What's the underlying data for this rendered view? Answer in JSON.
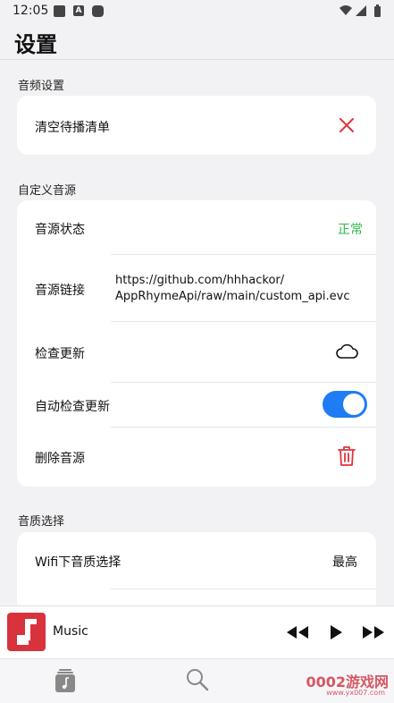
{
  "status_bar": {
    "time": "12:05",
    "a_badge": "A"
  },
  "page": {
    "title": "设置"
  },
  "audio_settings": {
    "section_label": "音频设置",
    "clear_queue_label": "清空待播清单"
  },
  "custom_source": {
    "section_label": "自定义音源",
    "source_status_label": "音源状态",
    "source_status_value": "正常",
    "source_link_label": "音源链接",
    "source_link_line1": "https://github.com/hhhackor/",
    "source_link_line2": "AppRhymeApi/raw/main/custom_api.evc",
    "check_update_label": "检查更新",
    "auto_check_label": "自动检查更新",
    "auto_check_enabled": true,
    "delete_source_label": "删除音源"
  },
  "quality": {
    "section_label": "音质选择",
    "wifi_quality_label": "Wifi下音质选择",
    "wifi_quality_value": "最高"
  },
  "player": {
    "track_title": "Music"
  },
  "watermark": {
    "text": "0002游戏网",
    "url": "www.yx007.com"
  },
  "colors": {
    "accent_blue": "#1f7cf5",
    "danger_red": "#e0333d",
    "ok_green": "#2db84d",
    "album_red": "#d8323c"
  },
  "icons": [
    "wifi-icon",
    "signal-icon",
    "battery-icon",
    "close-icon",
    "cloud-icon",
    "trash-icon",
    "music-note-icon",
    "rewind-icon",
    "play-icon",
    "fast-forward-icon",
    "library-icon",
    "search-icon"
  ]
}
